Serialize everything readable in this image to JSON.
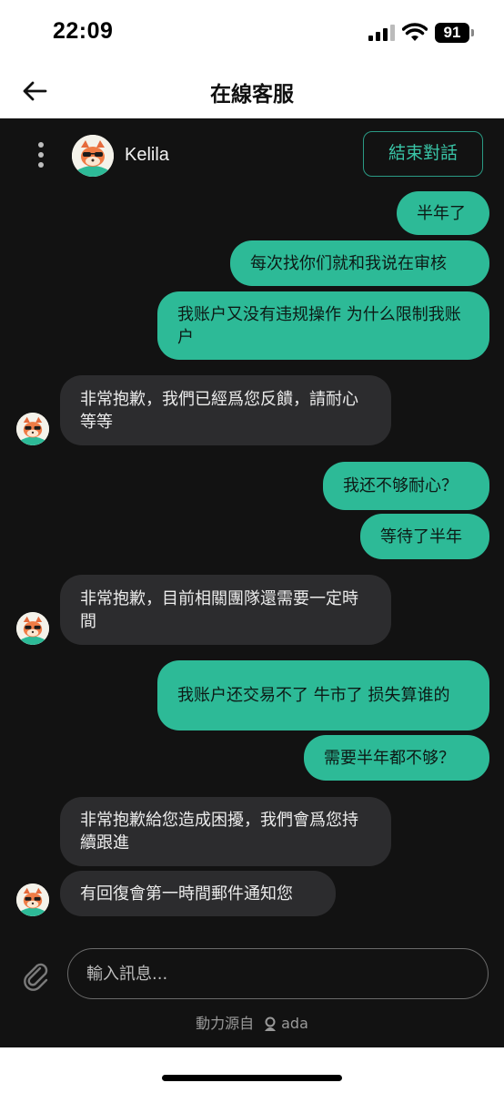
{
  "status": {
    "time": "22:09",
    "battery": "91"
  },
  "header": {
    "title": "在線客服"
  },
  "agent": {
    "name": "Kelila",
    "end_label": "結束對話"
  },
  "messages": [
    {
      "from": "user",
      "text": "半年了"
    },
    {
      "from": "user",
      "text": "每次找你们就和我说在审核"
    },
    {
      "from": "user",
      "text": "我账户又没有违规操作 为什么限制我账户"
    },
    {
      "from": "agent",
      "text": "非常抱歉，我們已經爲您反饋，請耐心等等"
    },
    {
      "from": "user",
      "text": "我还不够耐心？"
    },
    {
      "from": "user",
      "text": "等待了半年"
    },
    {
      "from": "agent",
      "text": "非常抱歉，目前相關團隊還需要一定時間"
    },
    {
      "from": "user",
      "text": "我账户还交易不了  牛市了 损失算谁的"
    },
    {
      "from": "user",
      "text": "需要半年都不够？"
    },
    {
      "from": "agent",
      "text": "非常抱歉給您造成困擾，我們會爲您持續跟進"
    },
    {
      "from": "agent",
      "text": "有回復會第一時間郵件通知您"
    }
  ],
  "composer": {
    "placeholder": "輸入訊息..."
  },
  "footer": {
    "powered_by": "動力源自",
    "brand": "ada"
  },
  "colors": {
    "accent": "#2dba97",
    "chat_bg": "#121212",
    "agent_bubble": "#2c2c2e"
  }
}
